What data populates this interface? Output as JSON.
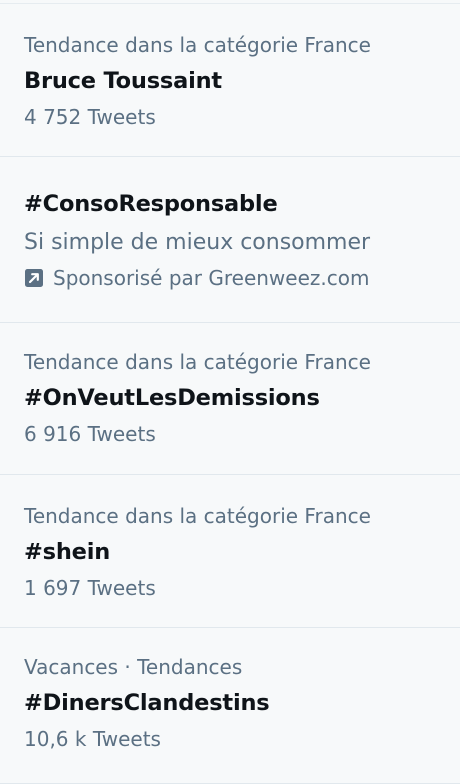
{
  "trends": [
    {
      "context": "Tendance dans la catégorie France",
      "name": "Bruce Toussaint",
      "count": "4 752 Tweets"
    },
    {
      "name": "#ConsoResponsable",
      "description": "Si simple de mieux consommer",
      "promoted": "Sponsorisé par Greenweez.com",
      "promoted_icon": "promoted-arrow-icon"
    },
    {
      "context": "Tendance dans la catégorie France",
      "name": "#OnVeutLesDemissions",
      "count": "6 916 Tweets"
    },
    {
      "context": "Tendance dans la catégorie France",
      "name": "#shein",
      "count": "1 697 Tweets"
    },
    {
      "context": "Vacances · Tendances",
      "name": "#DinersClandestins",
      "count": "10,6 k Tweets"
    }
  ],
  "colors": {
    "background": "#f7f9fa",
    "primary_text": "#0f1419",
    "secondary_text": "#5b7083",
    "divider": "#e1e8ed",
    "promo_icon": "#5b7083"
  }
}
